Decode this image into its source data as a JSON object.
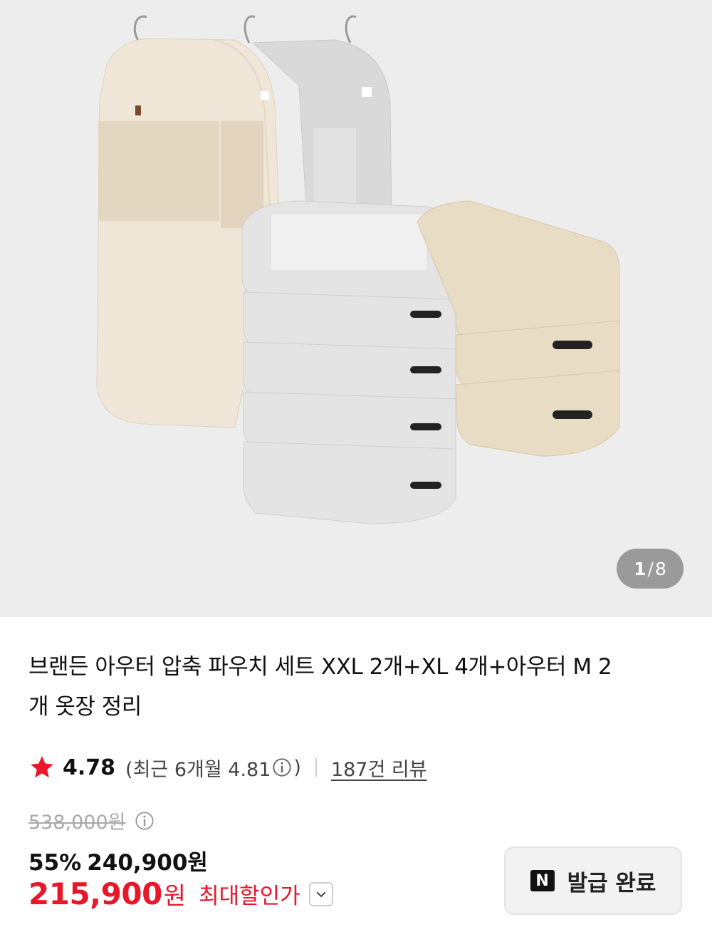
{
  "gallery": {
    "current": "1",
    "separator": "/",
    "total": "8",
    "image_alt": "아우터 압축 파우치 세트 상품 이미지"
  },
  "product": {
    "title": "브랜든 아우터 압축 파우치 세트 XXL 2개+XL 4개+아우터 M 2개 옷장 정리"
  },
  "rating": {
    "score": "4.78",
    "recent_text": "(최근 6개월 4.81",
    "recent_close": ")",
    "review_count": "187건 리뷰",
    "star_color": "#e8172a"
  },
  "price": {
    "original": "538,000원",
    "discount_percent": "55%",
    "discounted": "240,900원",
    "max_discount_amount": "215,900",
    "max_discount_unit": "원",
    "max_discount_label": "최대할인가",
    "accent_color": "#e8172a"
  },
  "coupon": {
    "logo": "N",
    "label": "발급 완료"
  },
  "icons": {
    "star": "star-icon",
    "info": "info-circle-icon",
    "chevron": "chevron-down-icon",
    "naver": "naver-logo-icon"
  }
}
